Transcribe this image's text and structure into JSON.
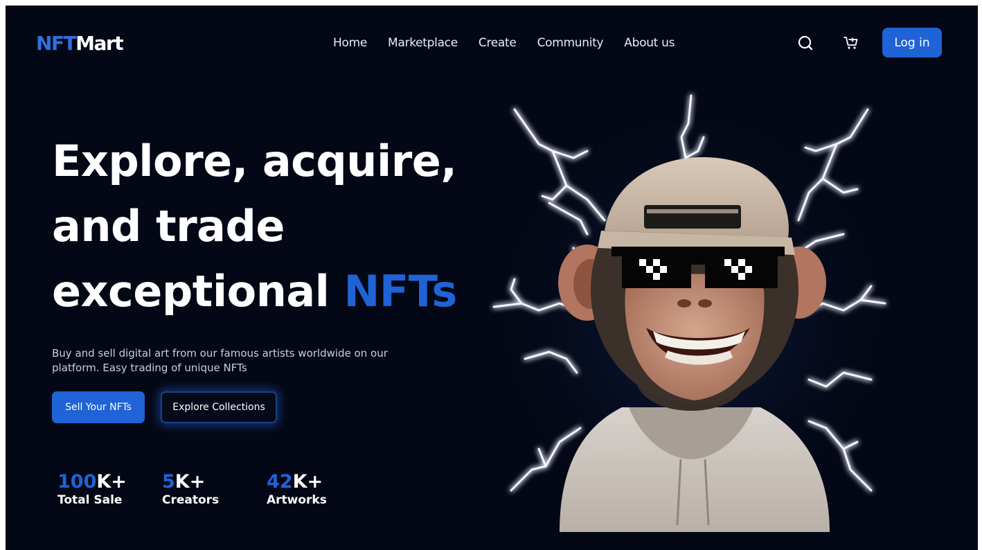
{
  "brand": {
    "logo_part1": "NFT",
    "logo_part2": "Mart"
  },
  "nav": {
    "items": [
      "Home",
      "Marketplace",
      "Create",
      "Community",
      "About us"
    ]
  },
  "header": {
    "search_icon": "search-icon",
    "cart_icon": "cart-icon",
    "login_label": "Log in"
  },
  "hero": {
    "line1": "Explore, acquire,",
    "line2": "and trade",
    "line3_plain": "exceptional ",
    "line3_accent": "NFTs",
    "subtitle": "Buy and sell digital art from our famous artists worldwide on our platform. Easy trading of unique NFTs",
    "primary_button": "Sell Your NFTs",
    "secondary_button": "Explore Collections"
  },
  "stats": [
    {
      "number": "100",
      "suffix": "K+",
      "label": "Total Sale"
    },
    {
      "number": "5",
      "suffix": "K+",
      "label": "Creators"
    },
    {
      "number": "42",
      "suffix": "K+",
      "label": "Artworks"
    }
  ],
  "colors": {
    "background": "#040816",
    "accent": "#1f63d6",
    "text": "#ffffff"
  }
}
